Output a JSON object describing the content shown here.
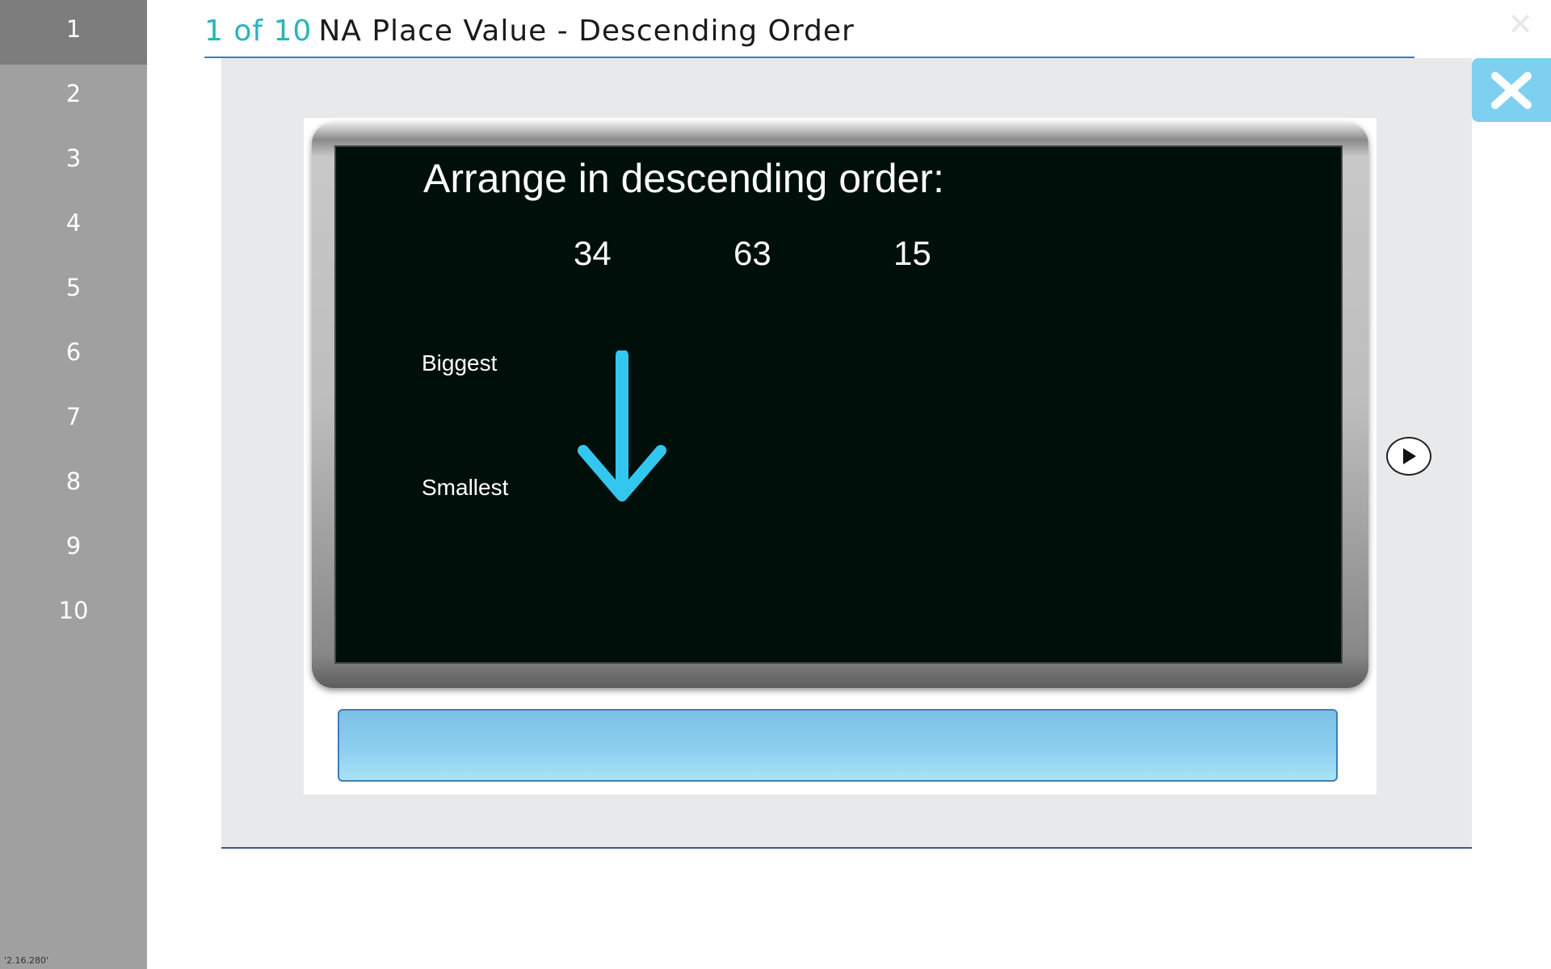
{
  "sidebar": {
    "items": [
      "1",
      "2",
      "3",
      "4",
      "5",
      "6",
      "7",
      "8",
      "9",
      "10"
    ],
    "active_index": 0,
    "version": "'2.16.280'"
  },
  "header": {
    "counter": "1 of 10",
    "title": "NA Place Value - Descending Order"
  },
  "slide": {
    "heading": "Arrange in descending order:",
    "numbers": [
      "34",
      "63",
      "15"
    ],
    "label_biggest": "Biggest",
    "label_smallest": "Smallest"
  },
  "icons": {
    "close": "close-icon",
    "play": "play-icon",
    "arrow": "arrow-down-icon"
  },
  "colors": {
    "accent": "#2bb3bc",
    "close_button": "#7ed0f1",
    "arrow": "#33c7f0",
    "header_rule": "#2f7fcf"
  }
}
